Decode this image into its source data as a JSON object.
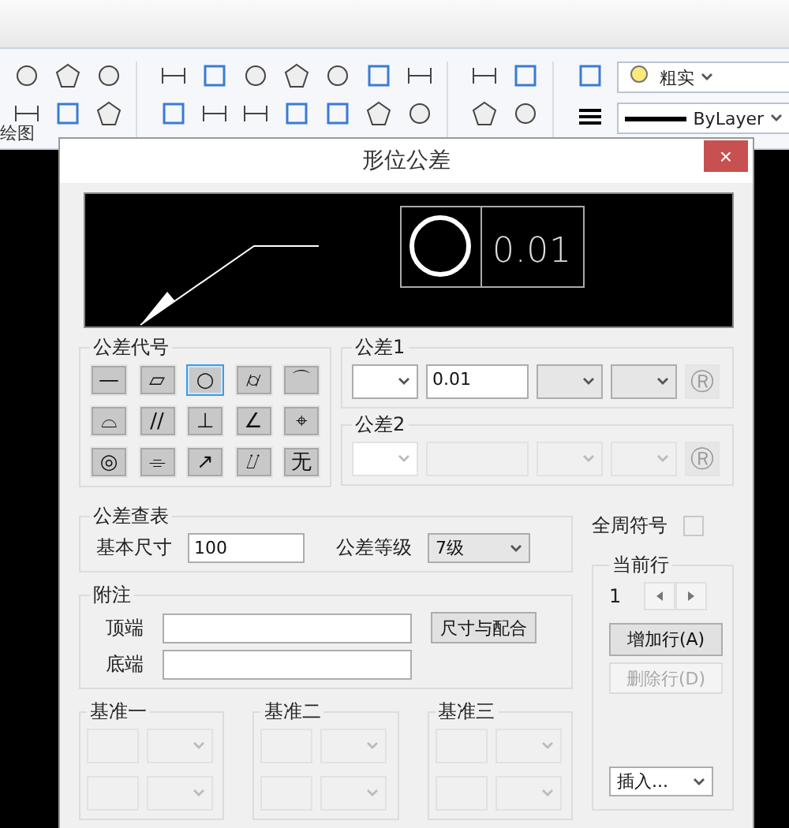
{
  "ribbon": {
    "layer_style": "粗实",
    "linetype": "ByLayer",
    "panel": "绘图"
  },
  "dialog": {
    "title": "形位公差",
    "close": "×",
    "preview": {
      "value": "0.01"
    },
    "symbol_group": {
      "title": "公差代号",
      "symbols": [
        {
          "glyph": "—",
          "selected": false
        },
        {
          "glyph": "▱",
          "selected": false
        },
        {
          "glyph": "○",
          "selected": true
        },
        {
          "glyph": "⌭",
          "selected": false
        },
        {
          "glyph": "⌒",
          "selected": false
        },
        {
          "glyph": "⌓",
          "selected": false
        },
        {
          "glyph": "//",
          "selected": false
        },
        {
          "glyph": "⊥",
          "selected": false
        },
        {
          "glyph": "∠",
          "selected": false
        },
        {
          "glyph": "⌖",
          "selected": false
        },
        {
          "glyph": "◎",
          "selected": false
        },
        {
          "glyph": "⌯",
          "selected": false
        },
        {
          "glyph": "↗",
          "selected": false
        },
        {
          "glyph": "⌰",
          "selected": false
        },
        {
          "glyph": "无",
          "selected": false
        }
      ]
    },
    "tolerances": [
      {
        "title": "公差1",
        "value": "0.01",
        "disabled": false,
        "material": "Ⓡ"
      },
      {
        "title": "公差2",
        "disabled": true,
        "material": "Ⓡ"
      }
    ],
    "lookup": {
      "title": "公差查表",
      "size_label": "基本尺寸",
      "size": "100",
      "grade_label": "公差等级",
      "grade": "7级"
    },
    "all_around": {
      "label": "全周符号",
      "checked": false
    },
    "note": {
      "title": "附注",
      "top_label": "顶端",
      "bottom_label": "底端",
      "fit_button": "尺寸与配合"
    },
    "current_row": {
      "title": "当前行",
      "row": "1",
      "add_button": "增加行(A)",
      "delete_button": {
        "label": "删除行(D)",
        "disabled": true
      },
      "insert": "插入..."
    },
    "datums": [
      {
        "title": "基准一"
      },
      {
        "title": "基准二"
      },
      {
        "title": "基准三"
      }
    ]
  }
}
